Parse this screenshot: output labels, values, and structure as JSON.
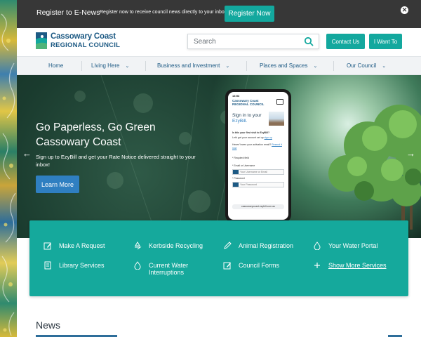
{
  "enews": {
    "title": "Register to E-News",
    "text": "Register now to receive council news directly to your inbox.",
    "button_label": "Register Now",
    "close_icon": "close-icon"
  },
  "header": {
    "logo_line1": "Cassowary Coast",
    "logo_line2": "REGIONAL COUNCIL",
    "search_placeholder": "Search",
    "contact_label": "Contact Us",
    "iwant_label": "I Want To"
  },
  "nav": {
    "items": [
      {
        "label": "Home",
        "dropdown": false
      },
      {
        "label": "Living Here",
        "dropdown": true
      },
      {
        "label": "Business and Investment",
        "dropdown": true
      },
      {
        "label": "Places and Spaces",
        "dropdown": true
      },
      {
        "label": "Our Council",
        "dropdown": true
      }
    ]
  },
  "hero": {
    "title": "Go Paperless, Go Green Cassowary Coast",
    "description": "Sign up to EzyBill and get your Rate Notice delivered straight to your inbox!",
    "button_label": "Learn More",
    "phone": {
      "time": "13:53",
      "logo": "Cassowary Coast REGIONAL COUNCIL",
      "sign_in": "Sign in to your",
      "brand": "EzyBill.",
      "first_visit": "Is this your first visit to EzyBill?",
      "hint1": "Let's get your account set up",
      "hint1_link": "sign up",
      "hint2": "Haven't seen your activation email?",
      "hint2_link": "Resend it now",
      "required": "* Required field",
      "email_label": "* Email or Username",
      "email_placeholder": "Your Username or Email",
      "password_label": "* Password",
      "password_placeholder": "Your Password",
      "url": "cassowarycoast.ezybill.com.au"
    }
  },
  "services": [
    {
      "label": "Make A Request",
      "icon": "pencil-square-icon"
    },
    {
      "label": "Kerbside Recycling",
      "icon": "recycle-icon"
    },
    {
      "label": "Animal Registration",
      "icon": "pencil-icon"
    },
    {
      "label": "Your Water Portal",
      "icon": "water-drop-icon"
    },
    {
      "label": "Library Services",
      "icon": "book-icon"
    },
    {
      "label": "Current Water Interruptions",
      "icon": "water-drop-icon"
    },
    {
      "label": "Council Forms",
      "icon": "pencil-square-icon"
    },
    {
      "label": "Show More Services",
      "icon": "plus-icon"
    }
  ],
  "news": {
    "heading": "News"
  },
  "colors": {
    "teal": "#13a89e",
    "dark_bar": "#373737",
    "brand_blue": "#1d5a84",
    "button_blue": "#2f7fc1"
  }
}
